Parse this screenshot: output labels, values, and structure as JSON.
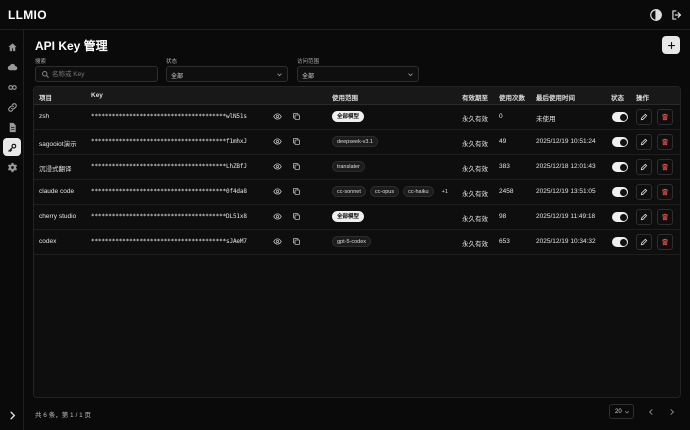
{
  "app": {
    "title": "LLMIO"
  },
  "page": {
    "title": "API Key 管理"
  },
  "filters": {
    "search_label": "搜索",
    "search_placeholder": "名称或 Key",
    "status_label": "状态",
    "status_value": "全部",
    "scope_label": "访问范围",
    "scope_value": "全部"
  },
  "table": {
    "headers": {
      "name": "项目",
      "key": "Key",
      "scope": "使用范围",
      "expiry": "有效期至",
      "count": "使用次数",
      "last_used": "最后使用时间",
      "status": "状态",
      "actions": "操作"
    },
    "rows": [
      {
        "name": "zsh",
        "key": "***************************************wlN51s",
        "tags": [
          "全部模型"
        ],
        "full": true,
        "expiry": "永久有效",
        "count": "0",
        "last_used": "未使用",
        "enabled": true
      },
      {
        "name": "sagooiot演示",
        "key": "***************************************f1mhxJ",
        "tags": [
          "deepseek-v3.1"
        ],
        "full": false,
        "expiry": "永久有效",
        "count": "49",
        "last_used": "2025/12/19 10:51:24",
        "enabled": true
      },
      {
        "name": "沉浸式翻译",
        "key": "***************************************LhZBfJ",
        "tags": [
          "translater"
        ],
        "full": false,
        "expiry": "永久有效",
        "count": "383",
        "last_used": "2025/12/18 12:01:43",
        "enabled": true
      },
      {
        "name": "claude code",
        "key": "***************************************0f4da8",
        "tags": [
          "cc-sonnet",
          "cc-opus",
          "cc-haiku",
          "+1"
        ],
        "full": false,
        "expiry": "永久有效",
        "count": "2458",
        "last_used": "2025/12/19 13:51:05",
        "enabled": true
      },
      {
        "name": "cherry studio",
        "key": "***************************************DL51x8",
        "tags": [
          "全部模型"
        ],
        "full": true,
        "expiry": "永久有效",
        "count": "98",
        "last_used": "2025/12/19 11:49:18",
        "enabled": true
      },
      {
        "name": "codex",
        "key": "***************************************sJAeM7",
        "tags": [
          "gpt-5-codex"
        ],
        "full": false,
        "expiry": "永久有效",
        "count": "653",
        "last_used": "2025/12/19 10:34:32",
        "enabled": true
      }
    ]
  },
  "footer": {
    "summary": "共 6 条，第 1 / 1 页",
    "page_size": "20"
  },
  "icons": {
    "sidebar": [
      "home-icon",
      "cloud-icon",
      "link-icon",
      "chain-icon",
      "document-icon",
      "key-icon",
      "gear-icon"
    ],
    "topbar": [
      "theme-toggle-icon",
      "logout-icon"
    ]
  },
  "colors": {
    "background": "#0a0a0a",
    "accent": "#f0f0f0",
    "danger": "#e05050"
  }
}
